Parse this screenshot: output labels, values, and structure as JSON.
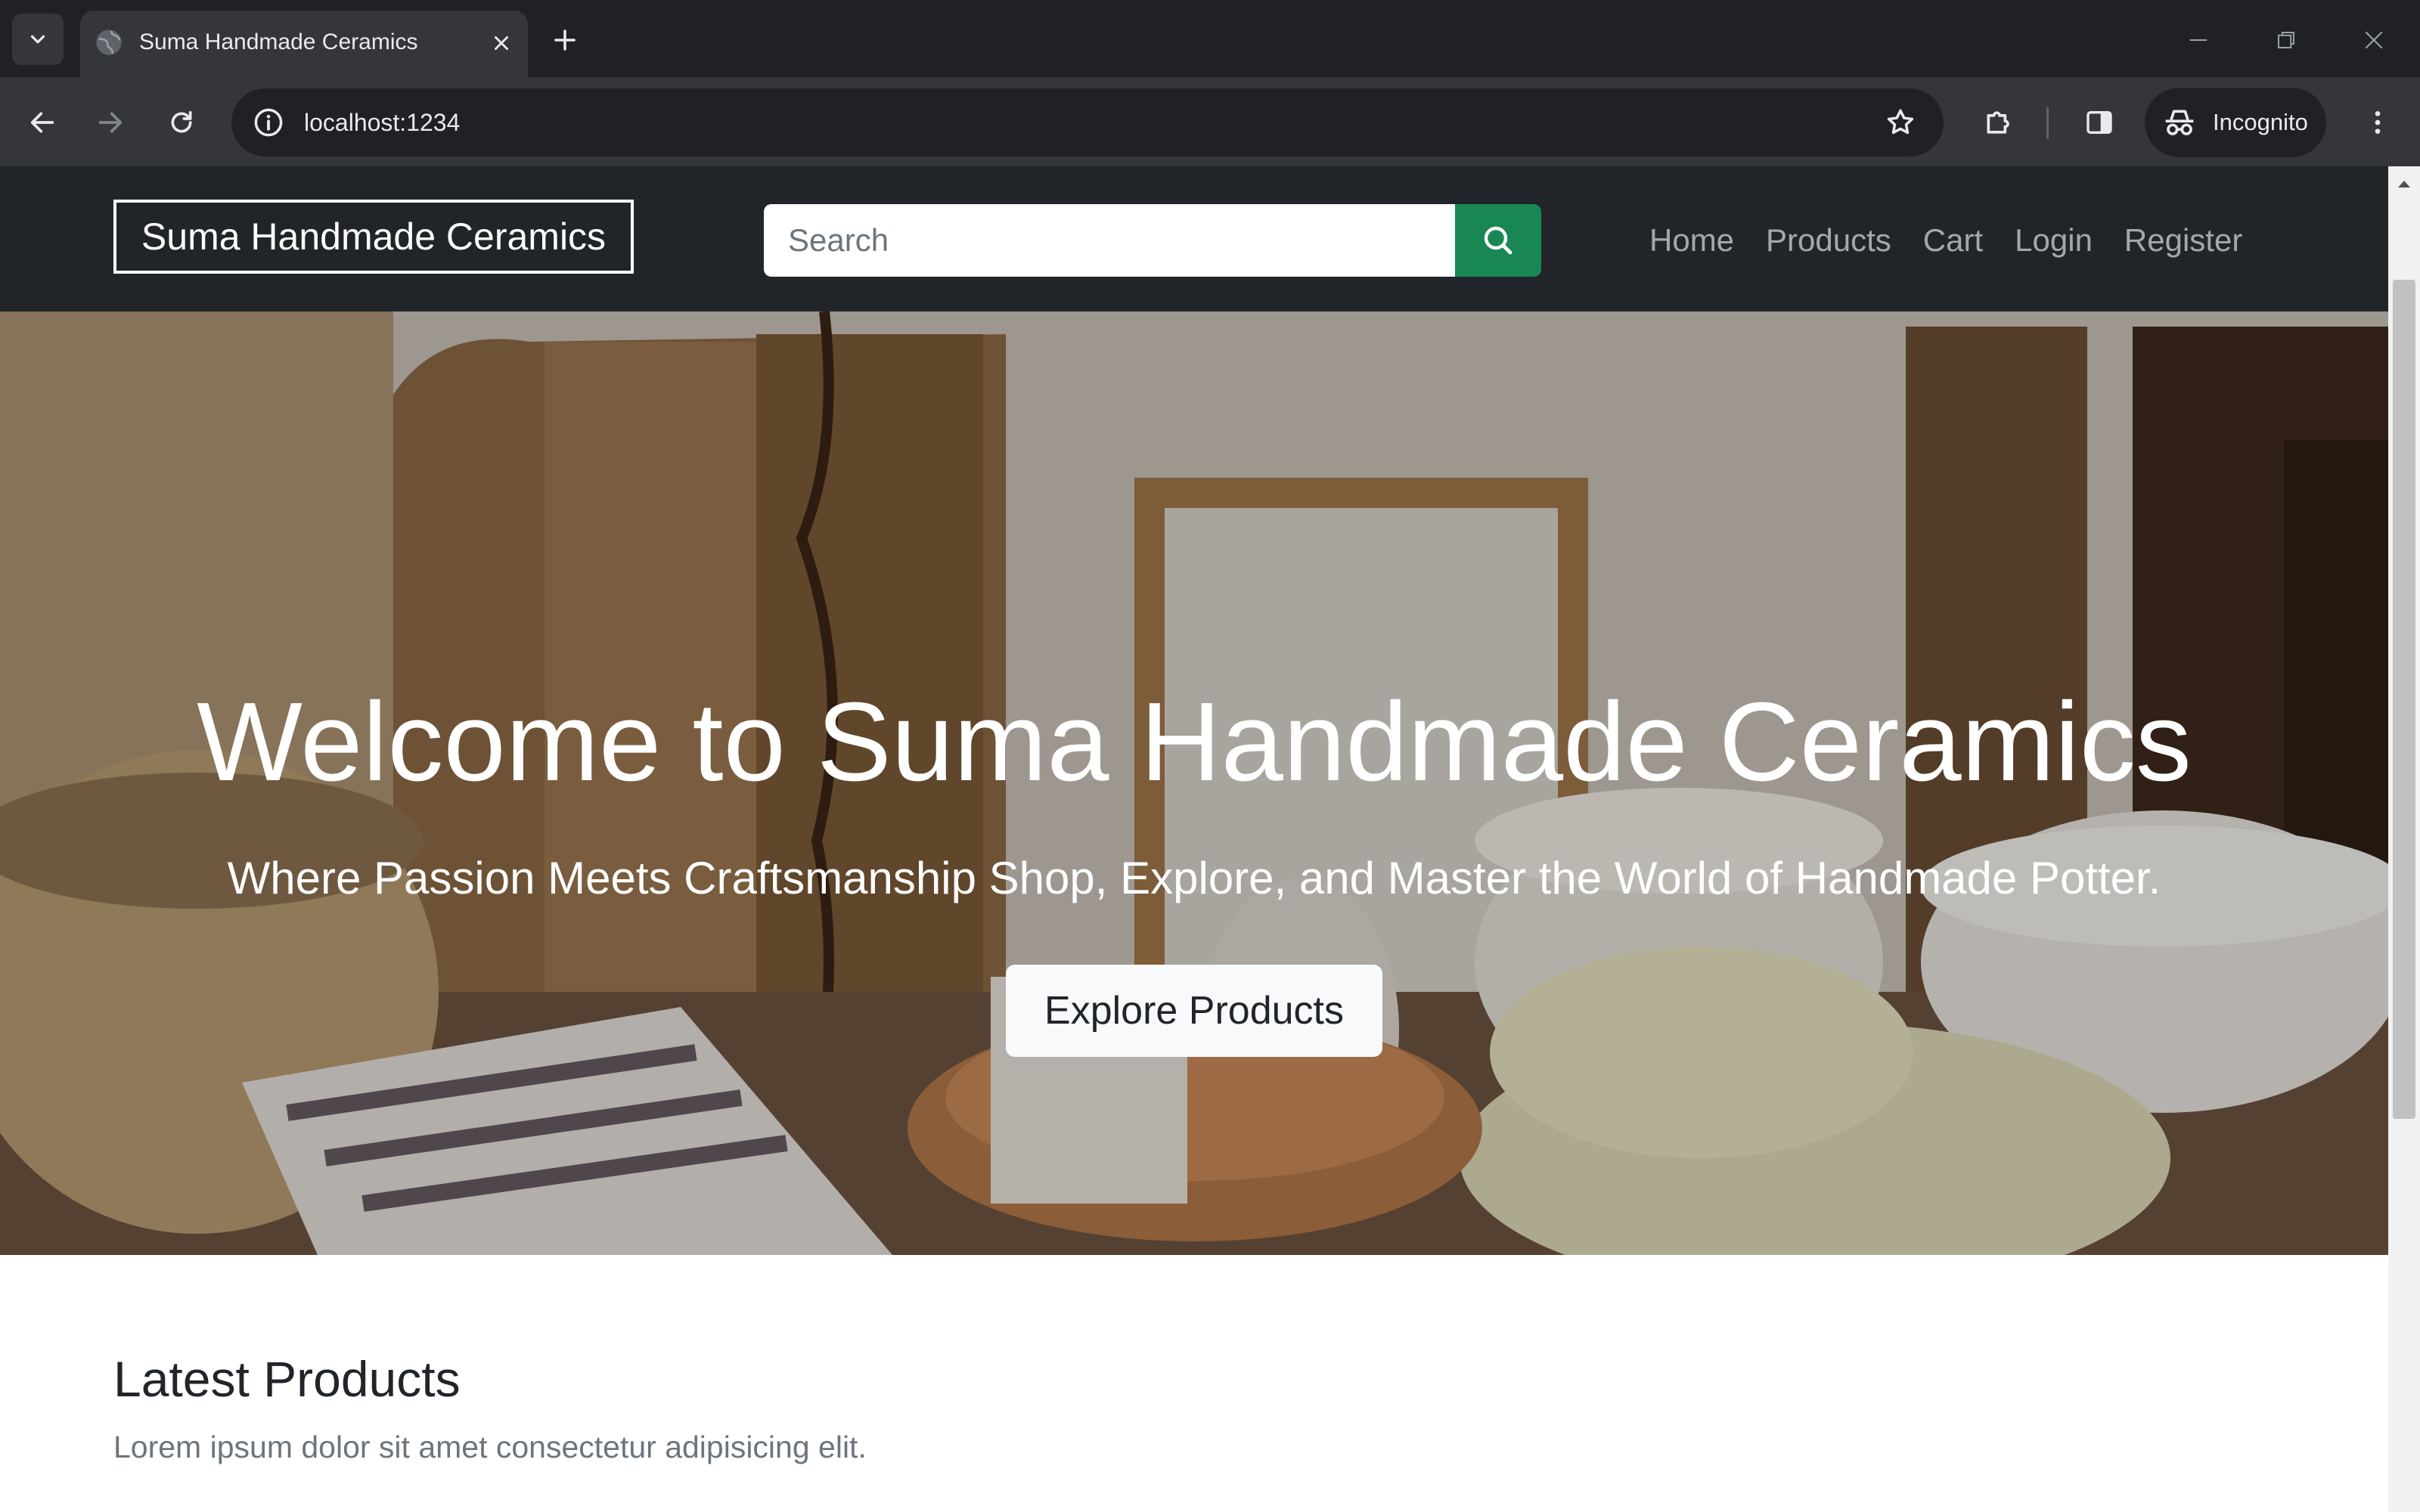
{
  "browser": {
    "tab": {
      "title": "Suma Handmade Ceramics"
    },
    "address_bar": {
      "url": "localhost:1234"
    },
    "profile": {
      "label": "Incognito"
    }
  },
  "navbar": {
    "brand": "Suma Handmade Ceramics",
    "search": {
      "placeholder": "Search"
    },
    "links": [
      "Home",
      "Products",
      "Cart",
      "Login",
      "Register"
    ]
  },
  "hero": {
    "title": "Welcome to Suma Handmade Ceramics",
    "subtitle": "Where Passion Meets Craftsmanship Shop, Explore, and Master the World of Handmade Potter.",
    "cta_label": "Explore Products"
  },
  "latest": {
    "title": "Latest Products",
    "description": "Lorem ipsum dolor sit amet consectetur adipisicing elit."
  },
  "colors": {
    "navbar_bg": "#212529",
    "search_button": "#198754",
    "hero_button_bg": "#f8f9fa"
  },
  "icons": {
    "tab_dropdown": "chevron-down-icon",
    "favicon": "globe-icon",
    "tab_close": "close-icon",
    "new_tab": "plus-icon",
    "back": "arrow-left-icon",
    "forward": "arrow-right-icon",
    "reload": "reload-icon",
    "site_info": "info-icon",
    "bookmark": "star-icon",
    "extensions": "puzzle-icon",
    "side_panel": "side-panel-icon",
    "incognito": "incognito-icon",
    "menu": "kebab-menu-icon",
    "search": "search-icon"
  }
}
